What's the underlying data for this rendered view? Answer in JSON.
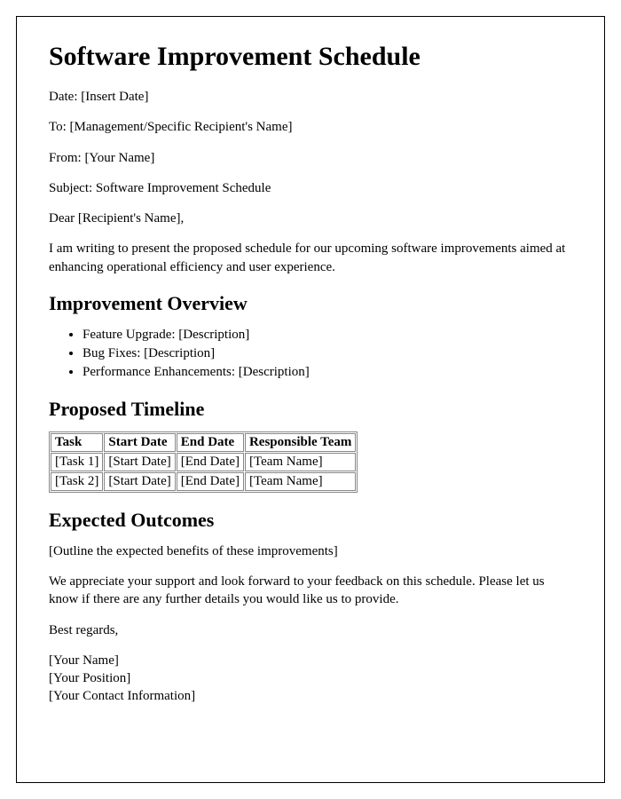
{
  "title": "Software Improvement Schedule",
  "meta": {
    "date_label": "Date: ",
    "date_value": "[Insert Date]",
    "to_label": "To: ",
    "to_value": "[Management/Specific Recipient's Name]",
    "from_label": "From: ",
    "from_value": "[Your Name]",
    "subject_label": "Subject: ",
    "subject_value": "Software Improvement Schedule"
  },
  "salutation": "Dear [Recipient's Name],",
  "intro": "I am writing to present the proposed schedule for our upcoming software improvements aimed at enhancing operational efficiency and user experience.",
  "overview": {
    "heading": "Improvement Overview",
    "items": [
      "Feature Upgrade: [Description]",
      "Bug Fixes: [Description]",
      "Performance Enhancements: [Description]"
    ]
  },
  "timeline": {
    "heading": "Proposed Timeline",
    "headers": [
      "Task",
      "Start Date",
      "End Date",
      "Responsible Team"
    ],
    "rows": [
      [
        "[Task 1]",
        "[Start Date]",
        "[End Date]",
        "[Team Name]"
      ],
      [
        "[Task 2]",
        "[Start Date]",
        "[End Date]",
        "[Team Name]"
      ]
    ]
  },
  "outcomes": {
    "heading": "Expected Outcomes",
    "text": "[Outline the expected benefits of these improvements]"
  },
  "closing": "We appreciate your support and look forward to your feedback on this schedule. Please let us know if there are any further details you would like us to provide.",
  "signoff": "Best regards,",
  "signature": {
    "name": "[Your Name]",
    "position": "[Your Position]",
    "contact": "[Your Contact Information]"
  }
}
